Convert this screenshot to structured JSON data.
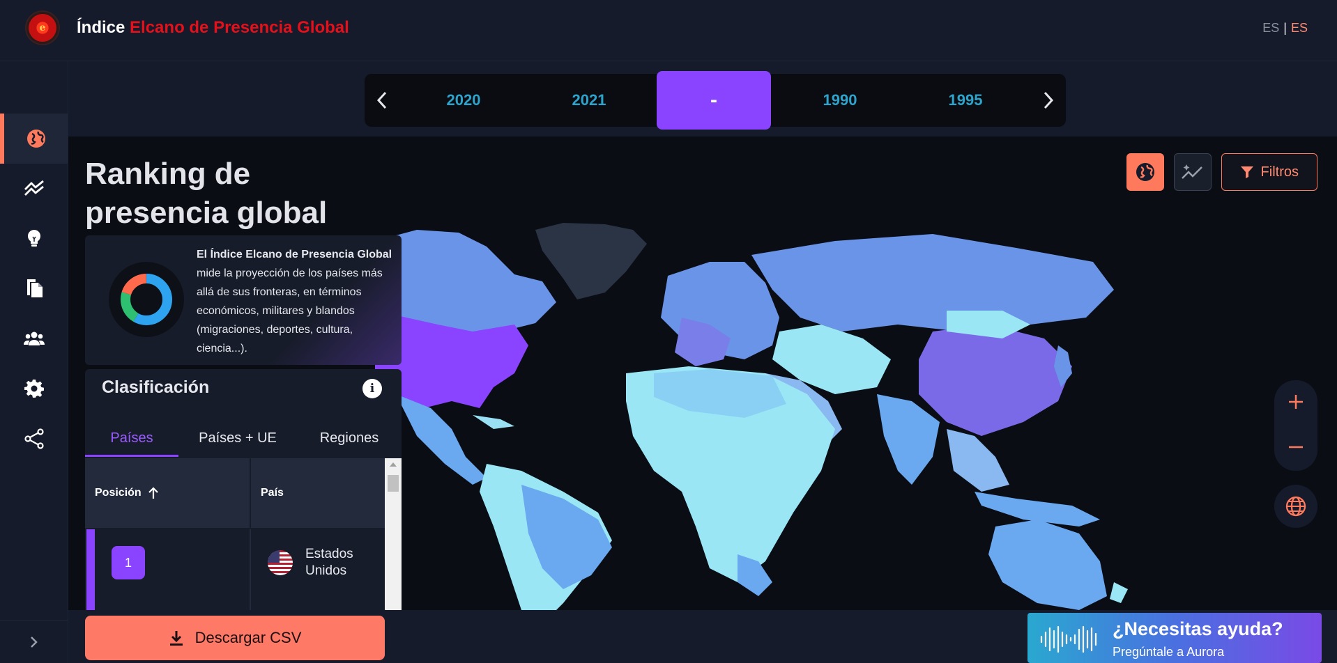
{
  "header": {
    "title_part1": "Índice",
    "title_part2": "Elcano de Presencia Global",
    "logo_letter": "e",
    "lang_left": "ES",
    "lang_separator": "|",
    "lang_active": "ES"
  },
  "sidebar": {
    "items": [
      {
        "icon": "globe-icon",
        "active": true
      },
      {
        "icon": "trend-icon",
        "active": false
      },
      {
        "icon": "lightbulb-icon",
        "active": false
      },
      {
        "icon": "documents-icon",
        "active": false
      },
      {
        "icon": "users-icon",
        "active": false
      },
      {
        "icon": "gear-icon",
        "active": false
      },
      {
        "icon": "share-icon",
        "active": false
      }
    ]
  },
  "yearbar": {
    "years": [
      "2020",
      "2021",
      "-",
      "1990",
      "1995"
    ],
    "active_index": 2
  },
  "main": {
    "title": "Ranking de presencia global",
    "filter_label": "Filtros"
  },
  "info_card": {
    "bold_text": "El Índice Elcano de Presencia Global",
    "text": " mide la proyección de los países más allá de sus fronteras, en términos económicos, militares y blandos (migraciones, deportes, cultura, ciencia...)."
  },
  "classification": {
    "title": "Clasificación",
    "info_symbol": "i",
    "tabs": [
      "Países",
      "Países + UE",
      "Regiones"
    ],
    "active_tab": 0,
    "columns": [
      "Posición",
      "País"
    ],
    "rows": [
      {
        "position": "1",
        "country": "Estados Unidos"
      }
    ]
  },
  "bottom": {
    "csv_label": "Descargar CSV",
    "help_title": "¿Necesitas ayuda?",
    "help_subtitle": "Pregúntale a Aurora"
  },
  "colors": {
    "accent": "#ff7a5c",
    "purple": "#8a43ff",
    "year_text": "#2ea4cc",
    "brand_red": "#e5101a"
  }
}
